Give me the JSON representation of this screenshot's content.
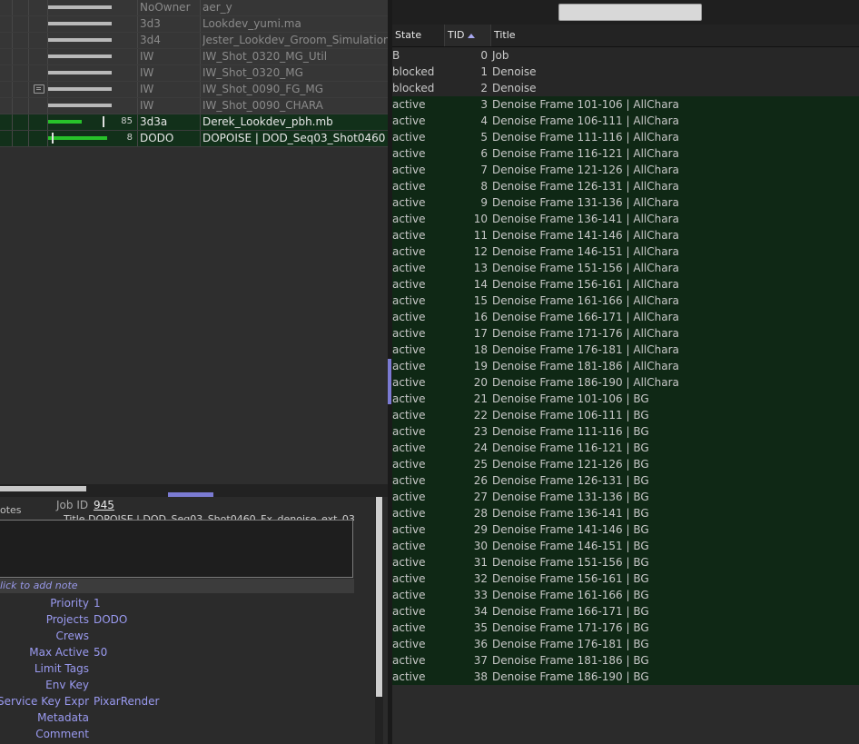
{
  "jobs": [
    {
      "owner": "NoOwner",
      "title": "aer_y",
      "style": "dim",
      "count": "",
      "progress": 0,
      "note": false
    },
    {
      "owner": "3d3",
      "title": "Lookdev_yumi.ma",
      "style": "dim",
      "count": "",
      "progress": 0,
      "note": false
    },
    {
      "owner": "3d4",
      "title": "Jester_Lookdev_Groom_Simulation",
      "style": "dim",
      "count": "",
      "progress": 0,
      "note": false
    },
    {
      "owner": "IW",
      "title": "IW_Shot_0320_MG_Util",
      "style": "dim",
      "count": "",
      "progress": 0,
      "note": false
    },
    {
      "owner": "IW",
      "title": "IW_Shot_0320_MG",
      "style": "dim",
      "count": "",
      "progress": 0,
      "note": false
    },
    {
      "owner": "IW",
      "title": "IW_Shot_0090_FG_MG",
      "style": "dim",
      "count": "",
      "progress": 0,
      "note": true
    },
    {
      "owner": "IW",
      "title": "IW_Shot_0090_CHARA",
      "style": "dim",
      "count": "",
      "progress": 0,
      "note": false
    },
    {
      "owner": "3d3a",
      "title": "Derek_Lookdev_pbh.mb",
      "style": "hl",
      "count": "85",
      "progress": 0.55,
      "note": false
    },
    {
      "owner": "DODO",
      "title": "DOPOISE | DOD_Seq03_Shot0460",
      "style": "hl",
      "count": "8",
      "progress": 0.95,
      "note": false
    }
  ],
  "details": {
    "notes_label": "otes",
    "job_id_label": "Job ID",
    "job_id": "945",
    "title_partial": "Title  DOPOISE | DOD_Seq03_Shot0460_Fx_denoise_ext_03",
    "click_note": "lick to add note",
    "properties": [
      {
        "label": "Priority",
        "value": "1"
      },
      {
        "label": "Projects",
        "value": "DODO"
      },
      {
        "label": "Crews",
        "value": ""
      },
      {
        "label": "Max Active",
        "value": "50"
      },
      {
        "label": "Limit Tags",
        "value": ""
      },
      {
        "label": "Env Key",
        "value": ""
      },
      {
        "label": "Service Key Expr",
        "value": "PixarRender"
      },
      {
        "label": "Metadata",
        "value": ""
      },
      {
        "label": "Comment",
        "value": ""
      }
    ]
  },
  "tasks": {
    "search_placeholder": "",
    "columns": {
      "state": "State",
      "tid": "TID",
      "title": "Title"
    },
    "rows": [
      {
        "state": "B",
        "tid": "0",
        "title": "Job"
      },
      {
        "state": "blocked",
        "tid": "1",
        "title": "Denoise"
      },
      {
        "state": "blocked",
        "tid": "2",
        "title": "Denoise"
      },
      {
        "state": "active",
        "tid": "3",
        "title": "Denoise Frame 101-106 | AllChara"
      },
      {
        "state": "active",
        "tid": "4",
        "title": "Denoise Frame 106-111 | AllChara"
      },
      {
        "state": "active",
        "tid": "5",
        "title": "Denoise Frame 111-116 | AllChara"
      },
      {
        "state": "active",
        "tid": "6",
        "title": "Denoise Frame 116-121 | AllChara"
      },
      {
        "state": "active",
        "tid": "7",
        "title": "Denoise Frame 121-126 | AllChara"
      },
      {
        "state": "active",
        "tid": "8",
        "title": "Denoise Frame 126-131 | AllChara"
      },
      {
        "state": "active",
        "tid": "9",
        "title": "Denoise Frame 131-136 | AllChara"
      },
      {
        "state": "active",
        "tid": "10",
        "title": "Denoise Frame 136-141 | AllChara"
      },
      {
        "state": "active",
        "tid": "11",
        "title": "Denoise Frame 141-146 | AllChara"
      },
      {
        "state": "active",
        "tid": "12",
        "title": "Denoise Frame 146-151 | AllChara"
      },
      {
        "state": "active",
        "tid": "13",
        "title": "Denoise Frame 151-156 | AllChara"
      },
      {
        "state": "active",
        "tid": "14",
        "title": "Denoise Frame 156-161 | AllChara"
      },
      {
        "state": "active",
        "tid": "15",
        "title": "Denoise Frame 161-166 | AllChara"
      },
      {
        "state": "active",
        "tid": "16",
        "title": "Denoise Frame 166-171 | AllChara"
      },
      {
        "state": "active",
        "tid": "17",
        "title": "Denoise Frame 171-176 | AllChara"
      },
      {
        "state": "active",
        "tid": "18",
        "title": "Denoise Frame 176-181 | AllChara"
      },
      {
        "state": "active",
        "tid": "19",
        "title": "Denoise Frame 181-186 | AllChara"
      },
      {
        "state": "active",
        "tid": "20",
        "title": "Denoise Frame 186-190 | AllChara"
      },
      {
        "state": "active",
        "tid": "21",
        "title": "Denoise Frame 101-106 | BG"
      },
      {
        "state": "active",
        "tid": "22",
        "title": "Denoise Frame 106-111 | BG"
      },
      {
        "state": "active",
        "tid": "23",
        "title": "Denoise Frame 111-116 | BG"
      },
      {
        "state": "active",
        "tid": "24",
        "title": "Denoise Frame 116-121 | BG"
      },
      {
        "state": "active",
        "tid": "25",
        "title": "Denoise Frame 121-126 | BG"
      },
      {
        "state": "active",
        "tid": "26",
        "title": "Denoise Frame 126-131 | BG"
      },
      {
        "state": "active",
        "tid": "27",
        "title": "Denoise Frame 131-136 | BG"
      },
      {
        "state": "active",
        "tid": "28",
        "title": "Denoise Frame 136-141 | BG"
      },
      {
        "state": "active",
        "tid": "29",
        "title": "Denoise Frame 141-146 | BG"
      },
      {
        "state": "active",
        "tid": "30",
        "title": "Denoise Frame 146-151 | BG"
      },
      {
        "state": "active",
        "tid": "31",
        "title": "Denoise Frame 151-156 | BG"
      },
      {
        "state": "active",
        "tid": "32",
        "title": "Denoise Frame 156-161 | BG"
      },
      {
        "state": "active",
        "tid": "33",
        "title": "Denoise Frame 161-166 | BG"
      },
      {
        "state": "active",
        "tid": "34",
        "title": "Denoise Frame 166-171 | BG"
      },
      {
        "state": "active",
        "tid": "35",
        "title": "Denoise Frame 171-176 | BG"
      },
      {
        "state": "active",
        "tid": "36",
        "title": "Denoise Frame 176-181 | BG"
      },
      {
        "state": "active",
        "tid": "37",
        "title": "Denoise Frame 181-186 | BG"
      },
      {
        "state": "active",
        "tid": "38",
        "title": "Denoise Frame 186-190 | BG"
      }
    ]
  },
  "colors": {
    "active_row": "#0f2815",
    "accent": "#9a9af0",
    "progress": "#27c22a"
  }
}
